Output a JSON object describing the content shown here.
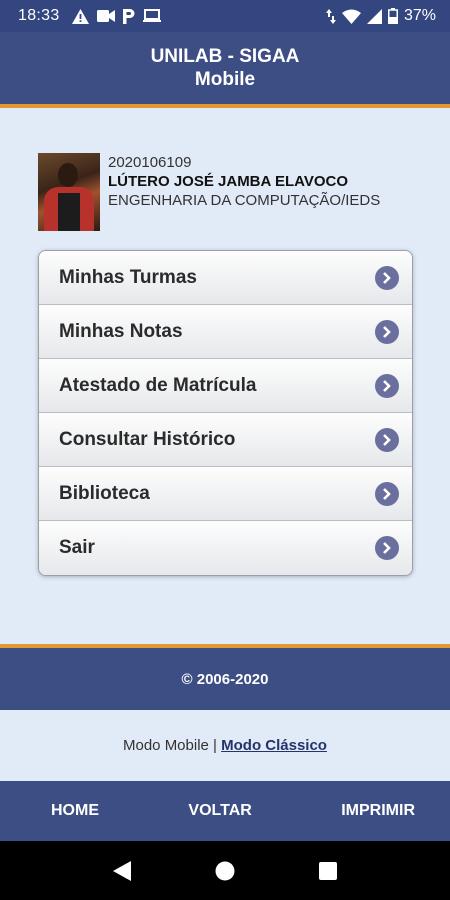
{
  "status_bar": {
    "time": "18:33",
    "battery": "37%",
    "left_icons": [
      "warning-icon",
      "video-icon",
      "parking-icon",
      "laptop-icon"
    ],
    "right_icons": [
      "data-arrows-icon",
      "wifi-icon",
      "signal-icon",
      "battery-icon"
    ]
  },
  "header": {
    "title_line1": "UNILAB - SIGAA",
    "title_line2": "Mobile"
  },
  "profile": {
    "id": "2020106109",
    "name": "LÚTERO JOSÉ JAMBA ELAVOCO",
    "course": "ENGENHARIA DA COMPUTAÇÃO/IEDS"
  },
  "menu": {
    "items": [
      {
        "label": "Minhas Turmas"
      },
      {
        "label": "Minhas Notas"
      },
      {
        "label": "Atestado de Matrícula"
      },
      {
        "label": "Consultar Histórico"
      },
      {
        "label": "Biblioteca"
      },
      {
        "label": "Sair"
      }
    ]
  },
  "footer": {
    "copyright": "© 2006-2020",
    "mode_mobile": "Modo Mobile",
    "separator": " | ",
    "mode_classic": "Modo Clássico"
  },
  "bottom_nav": {
    "home": "HOME",
    "back": "VOLTAR",
    "print": "IMPRIMIR"
  },
  "colors": {
    "header_bg": "#3d4e85",
    "accent_orange": "#e4962f",
    "content_bg": "#e1eaf7",
    "arrow_bg": "#6a6f9e"
  }
}
